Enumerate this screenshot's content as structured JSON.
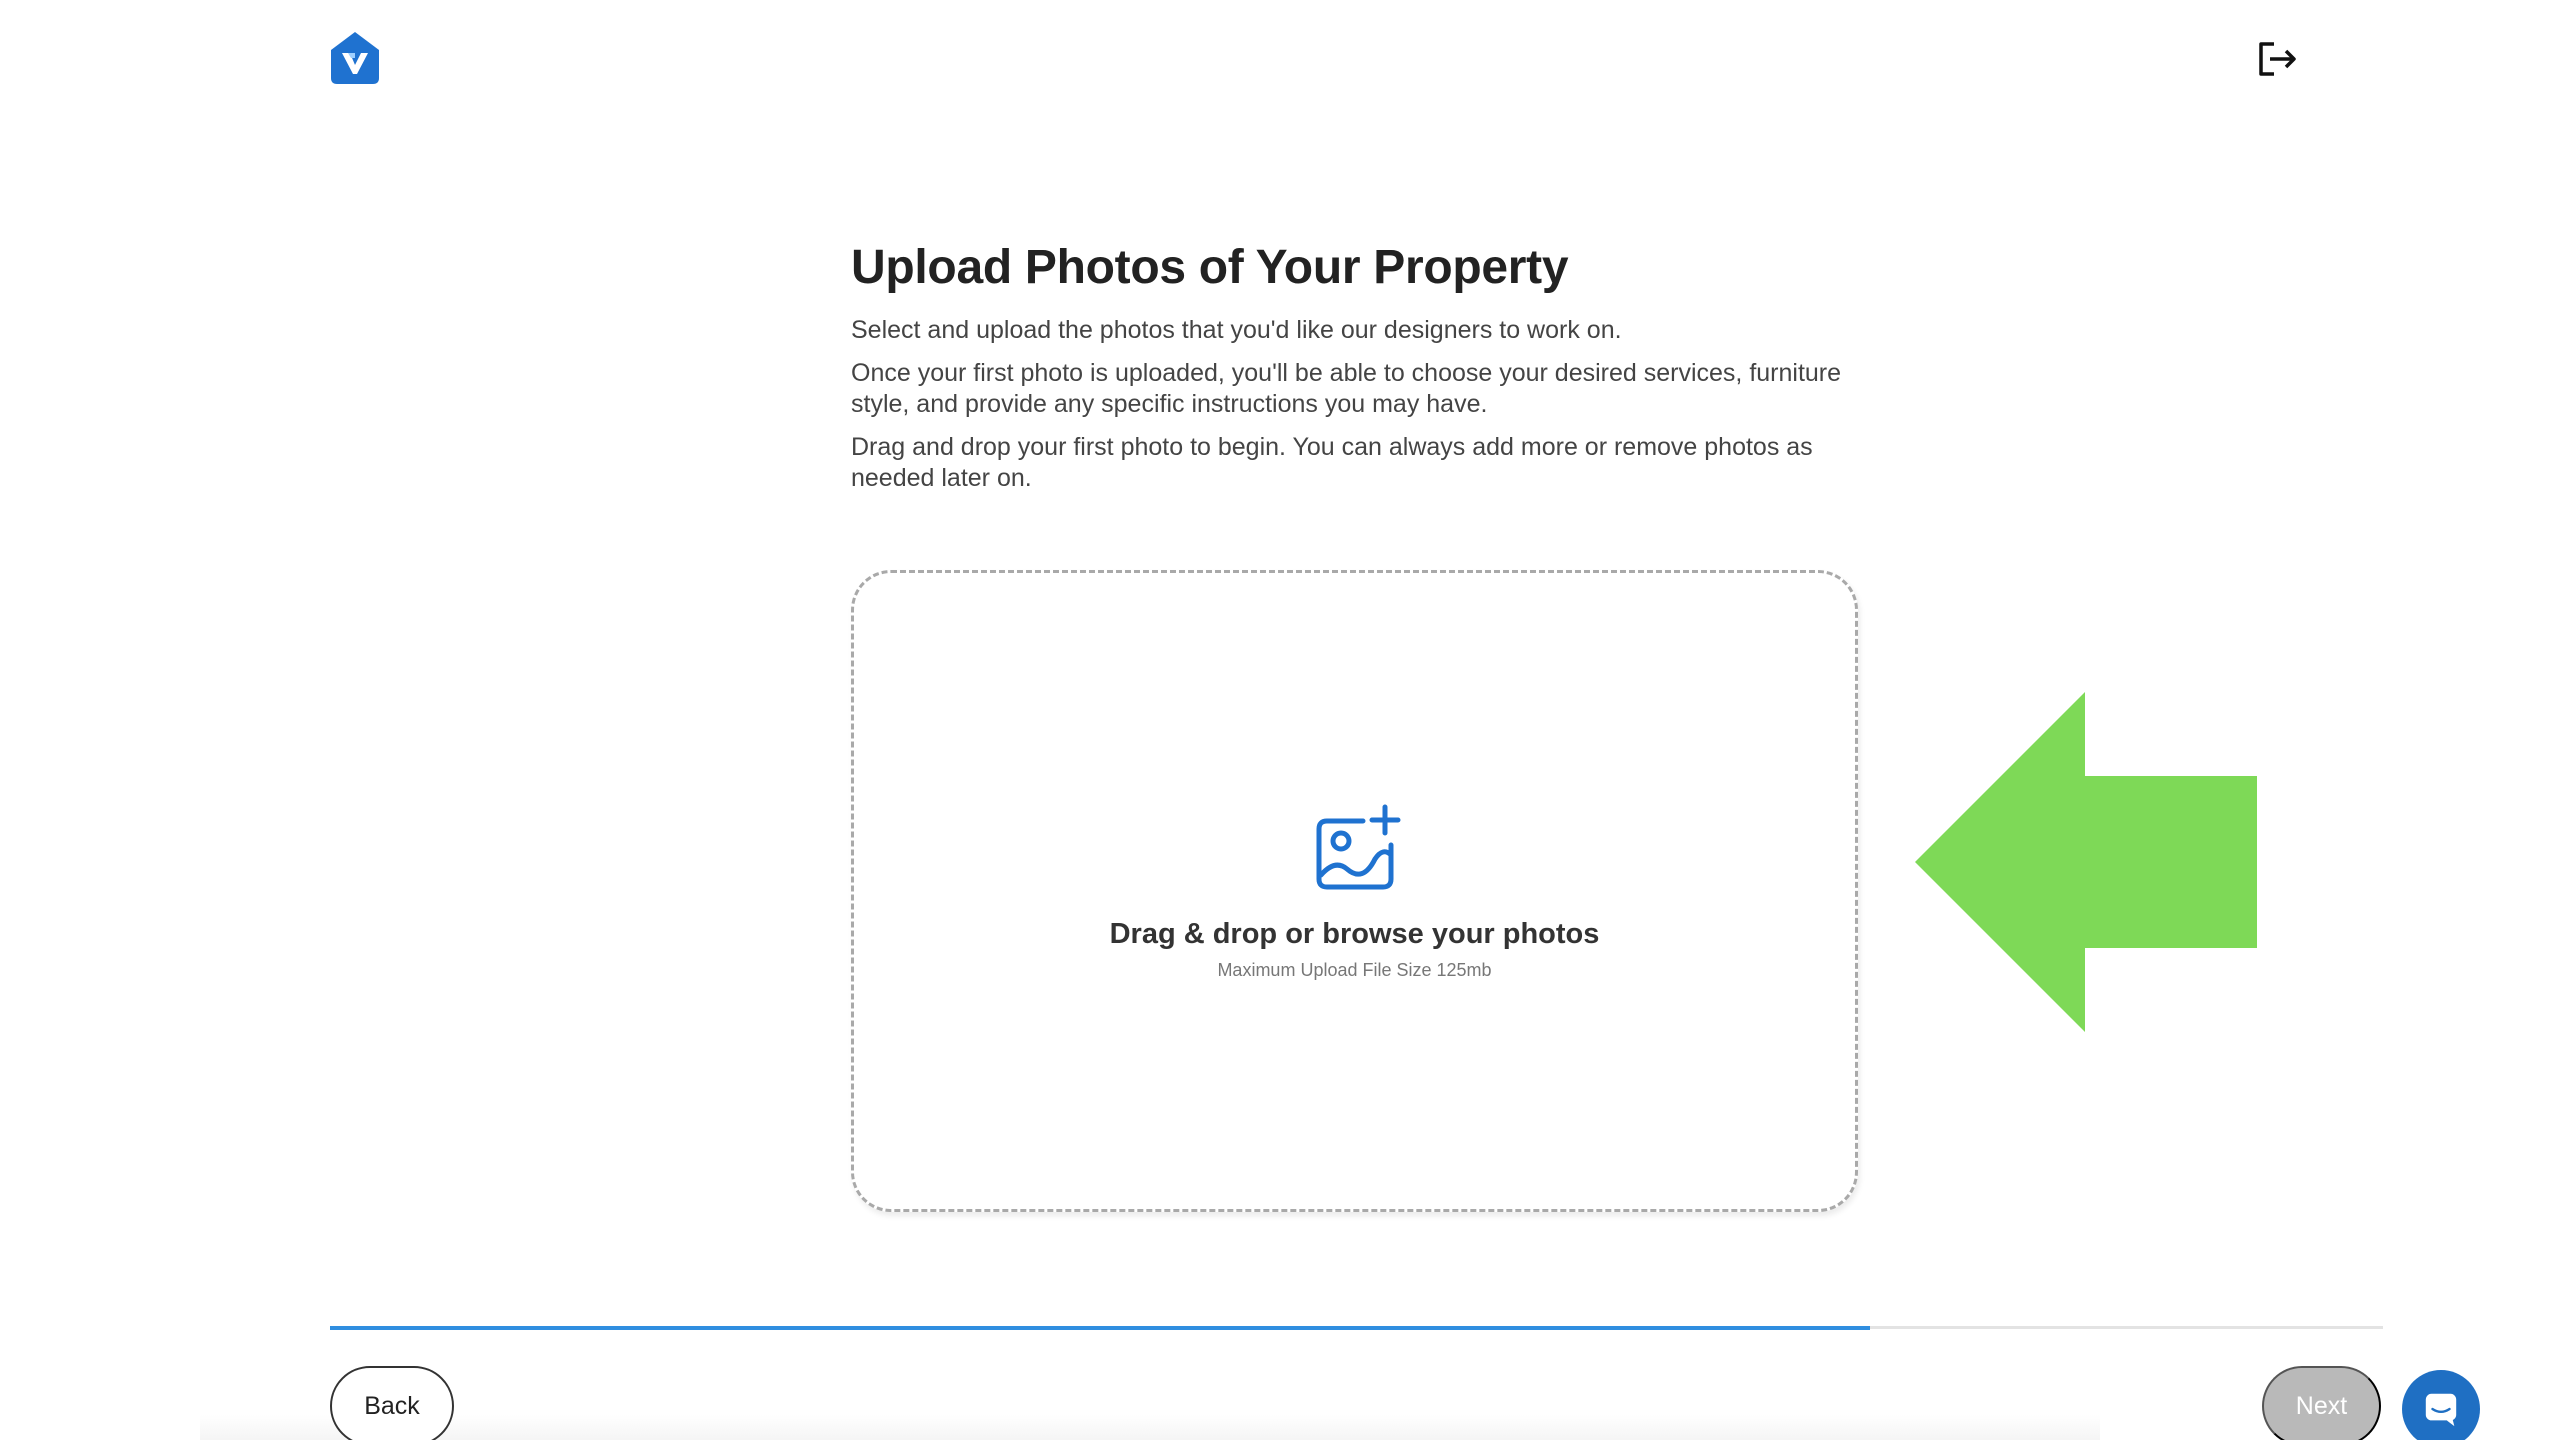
{
  "header": {
    "logo_icon": "house-logo-icon",
    "logout_icon": "logout-icon"
  },
  "main": {
    "title": "Upload Photos of Your Property",
    "paragraphs": [
      "Select and upload the photos that you'd like our designers to work on.",
      "Once your first photo is uploaded, you'll be able to choose your desired services, furniture style, and provide any specific instructions you may have.",
      "Drag and drop your first photo to begin. You can always add more or remove photos as needed later on."
    ]
  },
  "dropzone": {
    "icon": "add-photo-icon",
    "title": "Drag & drop or browse your photos",
    "subtitle": "Maximum Upload File Size 125mb"
  },
  "annotation": {
    "icon": "arrow-left-icon",
    "color": "#7ed957"
  },
  "progress": {
    "fraction": 0.75,
    "color": "#2f8ee0"
  },
  "footer": {
    "back_label": "Back",
    "next_label": "Next",
    "chat_icon": "chat-icon"
  },
  "colors": {
    "brand": "#1f72d0",
    "accent": "#2f8ee0"
  }
}
